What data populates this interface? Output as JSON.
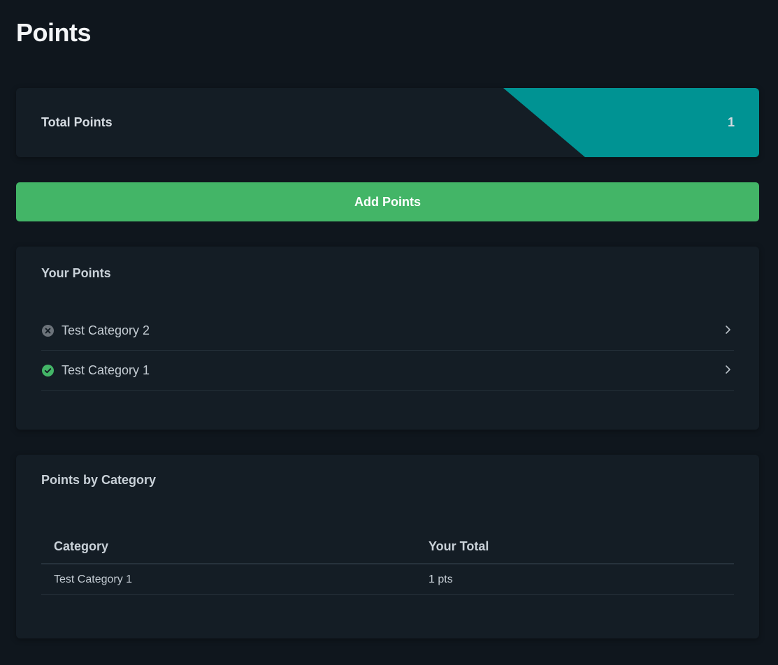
{
  "page": {
    "title": "Points"
  },
  "total_card": {
    "label": "Total Points",
    "value": "1",
    "accent_color": "#009393"
  },
  "add_button": {
    "label": "Add Points",
    "color": "#43b567"
  },
  "your_points": {
    "heading": "Your Points",
    "items": [
      {
        "label": "Test Category 2",
        "status": "incomplete",
        "icon": "x-circle-icon",
        "icon_color": "#6c737a"
      },
      {
        "label": "Test Category 1",
        "status": "complete",
        "icon": "check-circle-icon",
        "icon_color": "#43b567"
      }
    ]
  },
  "points_by_category": {
    "heading": "Points by Category",
    "columns": [
      "Category",
      "Your Total"
    ],
    "rows": [
      [
        "Test Category 1",
        "1 pts"
      ]
    ]
  }
}
